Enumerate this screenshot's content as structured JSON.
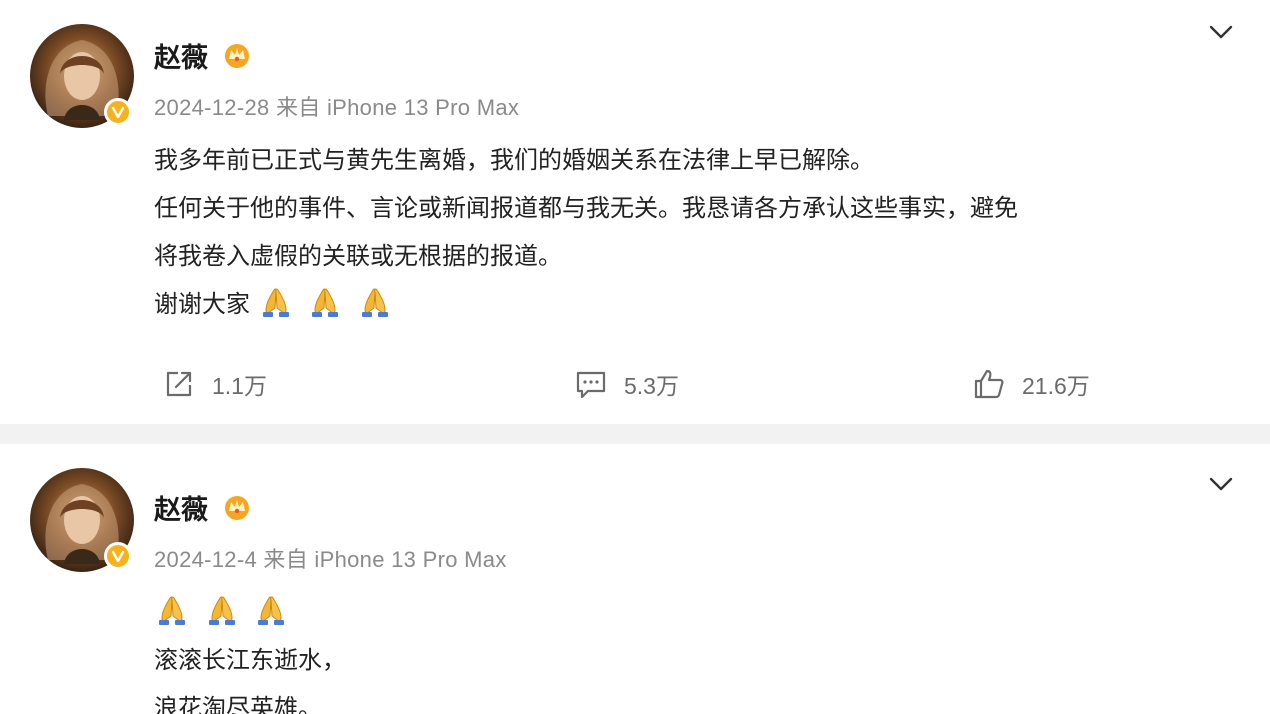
{
  "posts": [
    {
      "author": "赵薇",
      "time": "2024-12-28",
      "source": "来自 iPhone 13 Pro Max",
      "body": [
        "我多年前已正式与黄先生离婚，我们的婚姻关系在法律上早已解除。",
        "任何关于他的事件、言论或新闻报道都与我无关。我恳请各方承认这些事实，避免",
        "将我卷入虚假的关联或无根据的报道。",
        "谢谢大家"
      ],
      "emoji": "pray-icon",
      "reposts": "1.1万",
      "comments": "5.3万",
      "likes": "21.6万"
    },
    {
      "author": "赵薇",
      "time": "2024-12-4",
      "source": "来自 iPhone 13 Pro Max",
      "body": [
        "滚滚长江东逝水，",
        "浪花淘尽英雄。"
      ],
      "emoji": "pray-icon"
    }
  ],
  "colors": {
    "badge": "#f6b21c",
    "divider": "#f2f2f2",
    "meta_text": "#8a8a8a"
  }
}
